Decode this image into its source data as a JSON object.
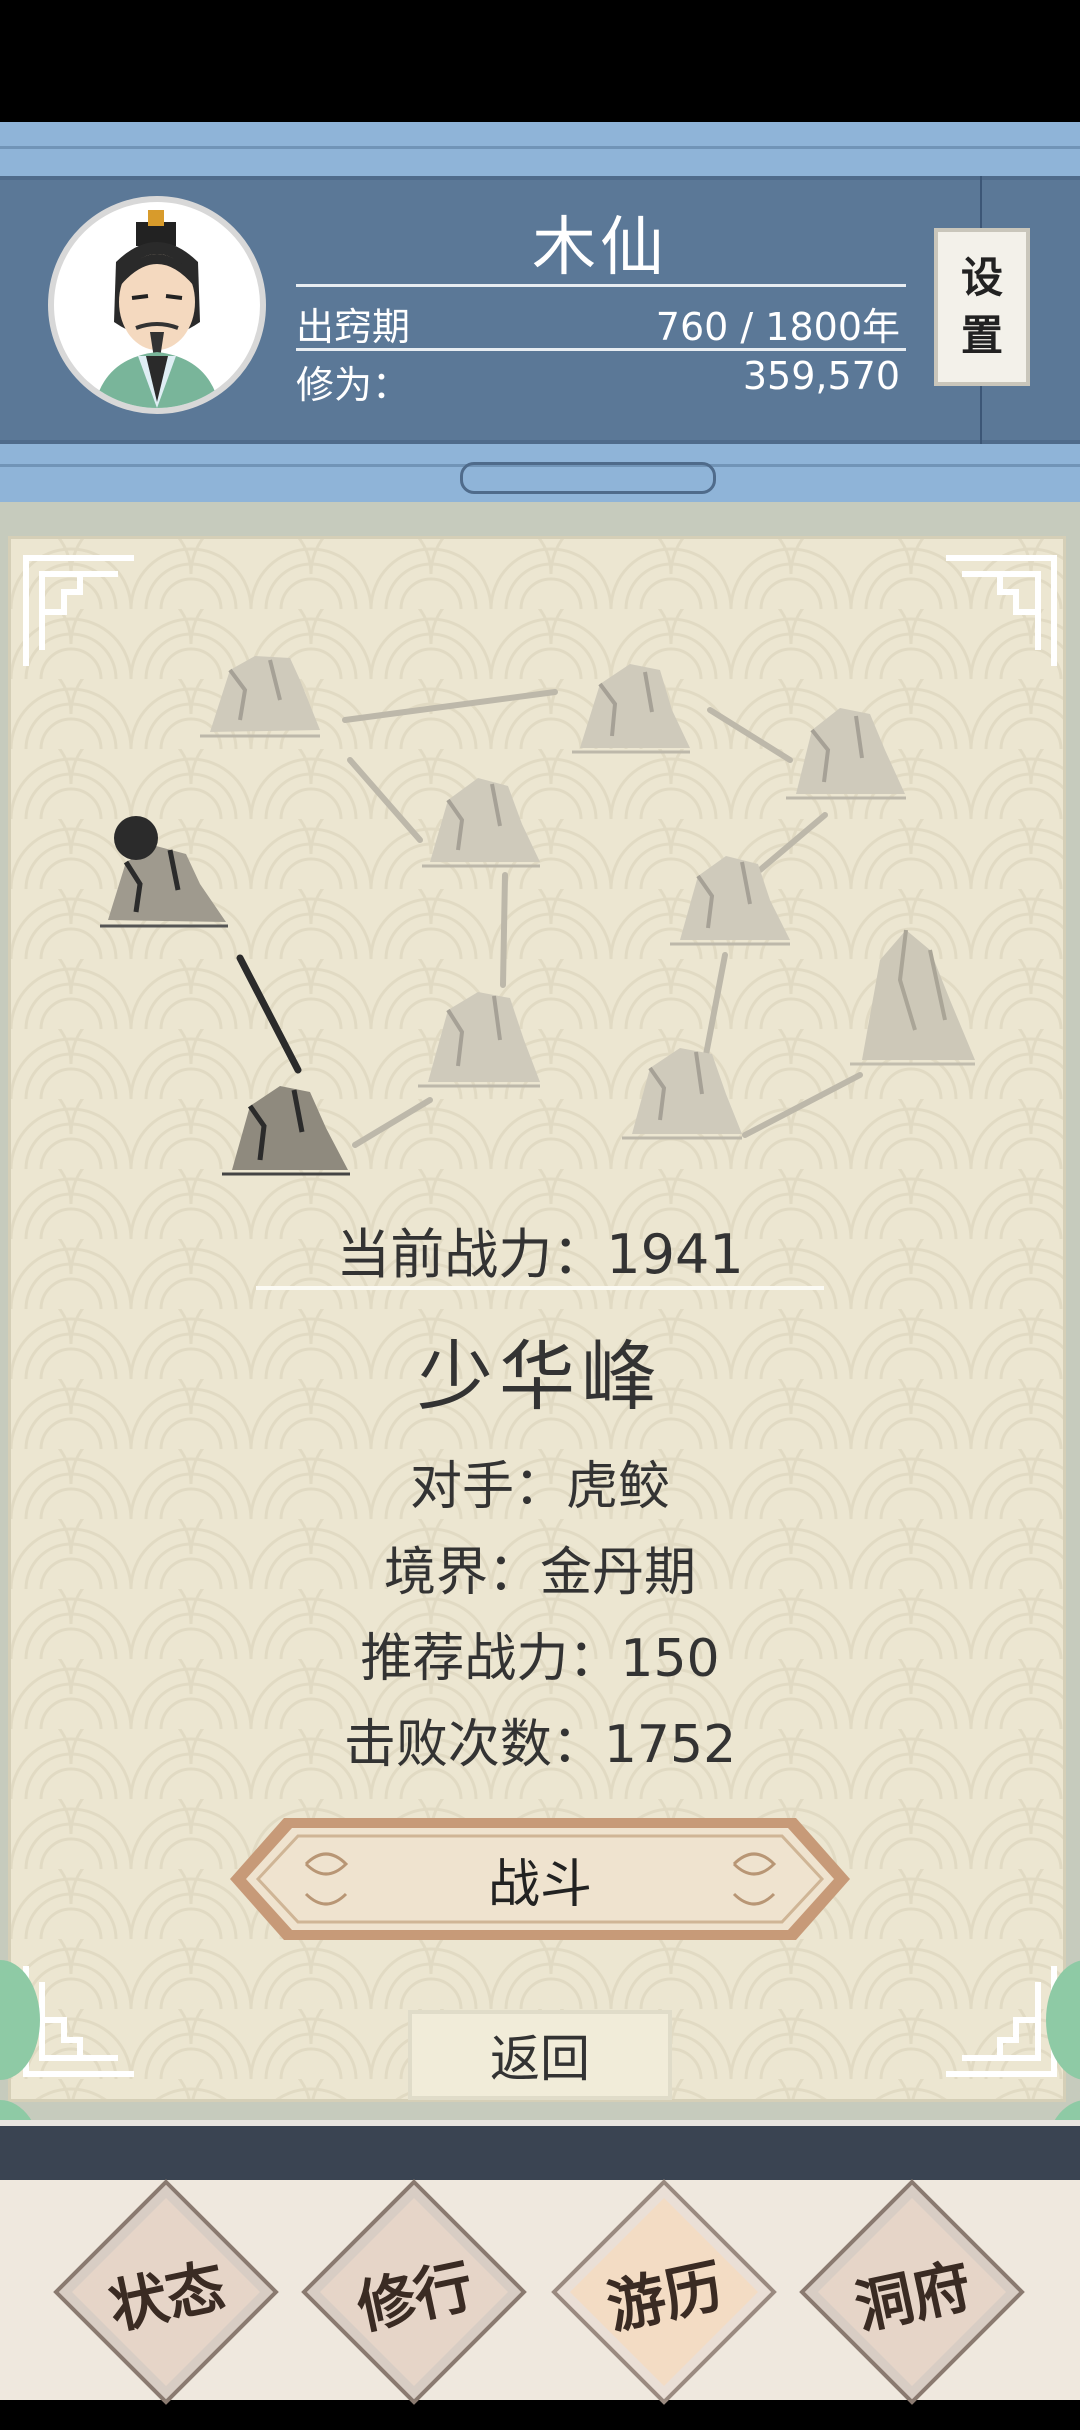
{
  "header": {
    "character_name": "木仙",
    "realm_label": "出窍期",
    "lifespan": "760 / 1800年",
    "cultivation_label": "修为：",
    "cultivation_value": "359,570",
    "settings_char1": "设",
    "settings_char2": "置"
  },
  "battle": {
    "current_power": "当前战力：1941",
    "location_name": "少华峰",
    "opponent": "对手：虎鲛",
    "realm": "境界：金丹期",
    "recommended_power": "推荐战力：150",
    "defeat_count": "击败次数：1752",
    "fight_button": "战斗",
    "back_button": "返回"
  },
  "nav": {
    "items": [
      "状态",
      "修行",
      "游历",
      "洞府"
    ],
    "active": "游历"
  },
  "colors": {
    "header_blue": "#5b7897",
    "panel_bg": "#ece6d1",
    "nav_bg": "#efe8de"
  }
}
